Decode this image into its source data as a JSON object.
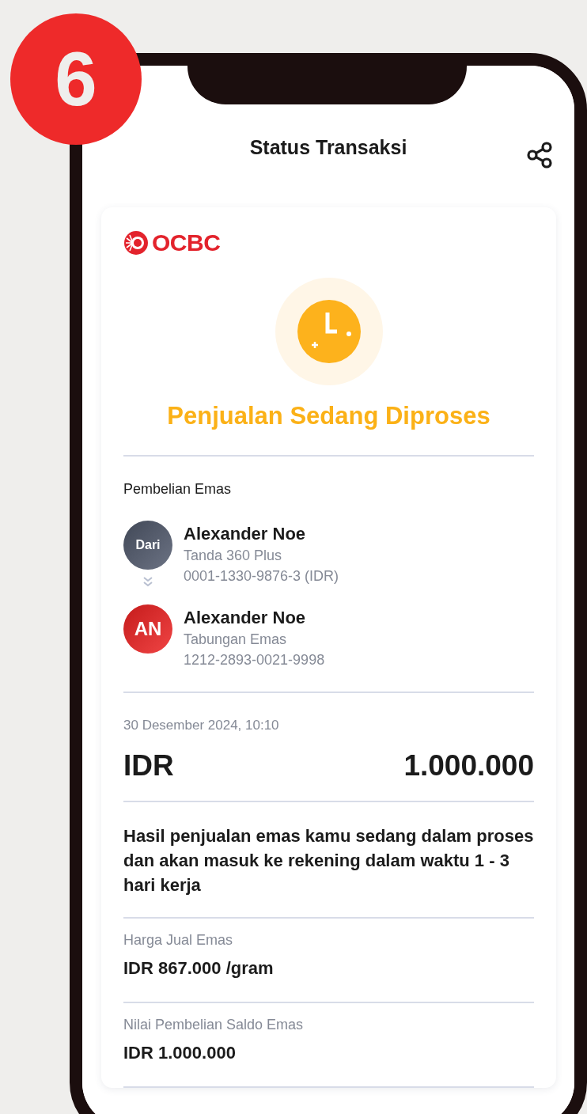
{
  "badge": "6",
  "title": "Status Transaksi",
  "brand": "OCBC",
  "status": "Penjualan Sedang Diproses",
  "section_label": "Pembelian Emas",
  "parties": [
    {
      "kind": "from",
      "avatar": "Dari",
      "name": "Alexander Noe",
      "account": "Tanda 360 Plus",
      "number": "0001-1330-9876-3 (IDR)"
    },
    {
      "kind": "to",
      "avatar": "AN",
      "name": "Alexander Noe",
      "account": "Tabungan Emas",
      "number": "1212-2893-0021-9998"
    }
  ],
  "datetime": "30 Desember 2024, 10:10",
  "amount": {
    "currency": "IDR",
    "value": "1.000.000"
  },
  "message": "Hasil penjualan emas kamu sedang dalam proses dan akan masuk ke rekening dalam waktu 1 - 3 hari kerja",
  "details": [
    {
      "label": "Harga Jual Emas",
      "value": "IDR 867.000 /gram"
    },
    {
      "label": "Nilai Pembelian Saldo Emas",
      "value": "IDR 1.000.000"
    }
  ]
}
